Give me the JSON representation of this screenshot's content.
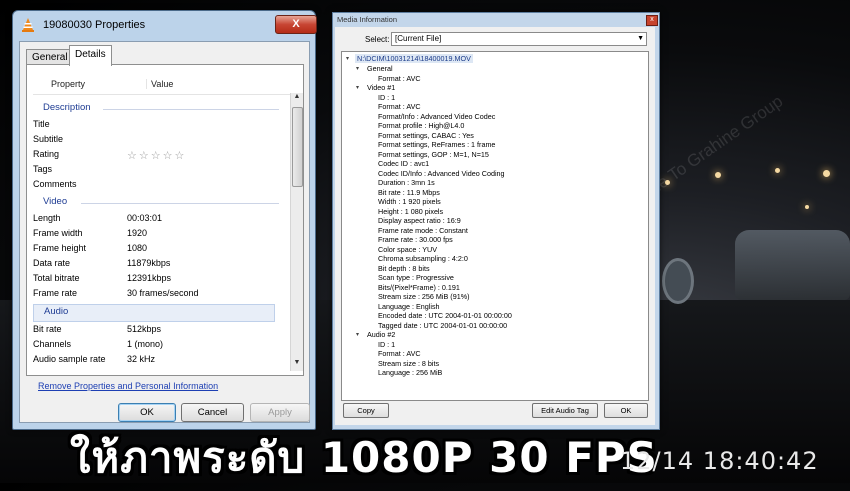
{
  "properties_window": {
    "title": "19080030 Properties",
    "close_glyph": "X",
    "tabs": [
      "General",
      "Details"
    ],
    "column_property": "Property",
    "column_value": "Value",
    "sections": {
      "description": "Description",
      "video": "Video",
      "audio": "Audio"
    },
    "description_rows": [
      {
        "key": "Title",
        "value": ""
      },
      {
        "key": "Subtitle",
        "value": ""
      },
      {
        "key": "Rating",
        "value": "☆☆☆☆☆"
      },
      {
        "key": "Tags",
        "value": ""
      },
      {
        "key": "Comments",
        "value": ""
      }
    ],
    "video_rows": [
      {
        "key": "Length",
        "value": "00:03:01"
      },
      {
        "key": "Frame width",
        "value": "1920"
      },
      {
        "key": "Frame height",
        "value": "1080"
      },
      {
        "key": "Data rate",
        "value": "11879kbps"
      },
      {
        "key": "Total bitrate",
        "value": "12391kbps"
      },
      {
        "key": "Frame rate",
        "value": "30 frames/second"
      }
    ],
    "audio_rows": [
      {
        "key": "Bit rate",
        "value": "512kbps"
      },
      {
        "key": "Channels",
        "value": "1 (mono)"
      },
      {
        "key": "Audio sample rate",
        "value": "32 kHz"
      }
    ],
    "remove_link": "Remove Properties and Personal Information",
    "ok_label": "OK",
    "cancel_label": "Cancel",
    "apply_label": "Apply"
  },
  "media_window": {
    "title": "Media Information",
    "close_glyph": "x",
    "select_label": "Select:",
    "select_value": "[Current File]",
    "root": "N:\\DCIM\\10031214\\18400019.MOV",
    "groups": [
      {
        "label": "General",
        "items": [
          "Format : AVC"
        ]
      },
      {
        "label": "Video #1",
        "items": [
          "ID : 1",
          "Format : AVC",
          "Format/Info : Advanced Video Codec",
          "Format profile : High@L4.0",
          "Format settings, CABAC : Yes",
          "Format settings, ReFrames : 1 frame",
          "Format settings, GOP : M=1, N=15",
          "Codec ID : avc1",
          "Codec ID/Info : Advanced Video Coding",
          "Duration : 3mn 1s",
          "Bit rate : 11.9 Mbps",
          "Width : 1 920 pixels",
          "Height : 1 080 pixels",
          "Display aspect ratio : 16:9",
          "Frame rate mode : Constant",
          "Frame rate : 30.000 fps",
          "Color space : YUV",
          "Chroma subsampling : 4:2:0",
          "Bit depth : 8 bits",
          "Scan type : Progressive",
          "Bits/(Pixel*Frame) : 0.191",
          "Stream size : 256 MiB (91%)",
          "Language : English",
          "Encoded date : UTC 2004-01-01 00:00:00",
          "Tagged date : UTC 2004-01-01 00:00:00"
        ]
      },
      {
        "label": "Audio #2",
        "items": [
          "ID : 1",
          "Format : AVC",
          "Stream size : 8 bits",
          "Language : 256 MiB"
        ]
      }
    ],
    "copy_label": "Copy",
    "edit_label": "Edit Audio Tag",
    "ok_label": "OK"
  },
  "overlay": {
    "caption": "ให้ภาพระดับ 1080P 30 FPS",
    "timestamp": "12/14 18:40:42",
    "watermark": "Welcome To Grahine Group"
  }
}
